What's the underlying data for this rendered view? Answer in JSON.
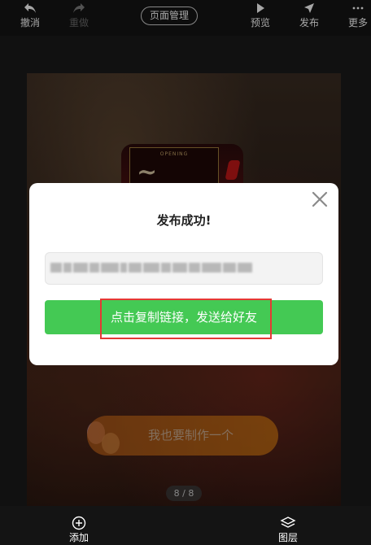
{
  "toolbar": {
    "undo_label": "撤消",
    "redo_label": "重做",
    "page_manage_label": "页面管理",
    "preview_label": "预览",
    "publish_label": "发布",
    "more_label": "更多"
  },
  "canvas": {
    "poster_tag": "OPENING",
    "make_button_label": "我也要制作一个",
    "page_indicator": "8 / 8"
  },
  "modal": {
    "title": "发布成功!",
    "copy_button_label": "点击复制链接，发送给好友"
  },
  "bottom_bar": {
    "add_label": "添加",
    "layers_label": "图层"
  },
  "colors": {
    "accent_green": "#44c954",
    "highlight_red": "#e53935",
    "toolbar_bg": "#141414"
  }
}
